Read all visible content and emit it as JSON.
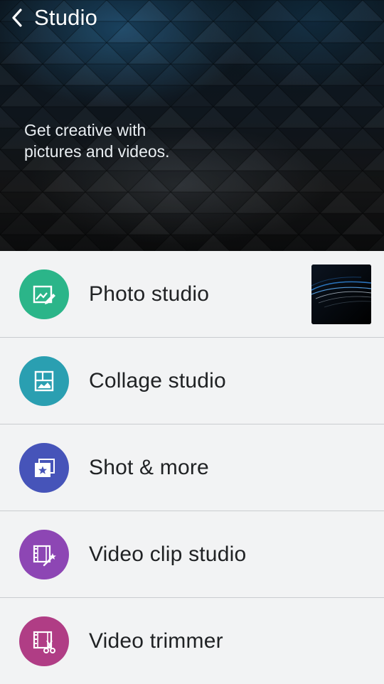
{
  "header": {
    "title": "Studio",
    "tagline": "Get creative with\npictures and videos."
  },
  "items": [
    {
      "label": "Photo studio",
      "icon": "photo-edit-icon",
      "color": "#2bb589",
      "has_thumbnail": true
    },
    {
      "label": "Collage studio",
      "icon": "collage-icon",
      "color": "#2a9fb1",
      "has_thumbnail": false
    },
    {
      "label": "Shot & more",
      "icon": "shot-star-icon",
      "color": "#4654b9",
      "has_thumbnail": false
    },
    {
      "label": "Video clip studio",
      "icon": "video-clip-magic-icon",
      "color": "#8d46b4",
      "has_thumbnail": false
    },
    {
      "label": "Video trimmer",
      "icon": "video-trim-scissors-icon",
      "color": "#b03d85",
      "has_thumbnail": false
    }
  ],
  "colors": {
    "list_background": "#f2f3f4",
    "divider": "#c9ccd0"
  }
}
